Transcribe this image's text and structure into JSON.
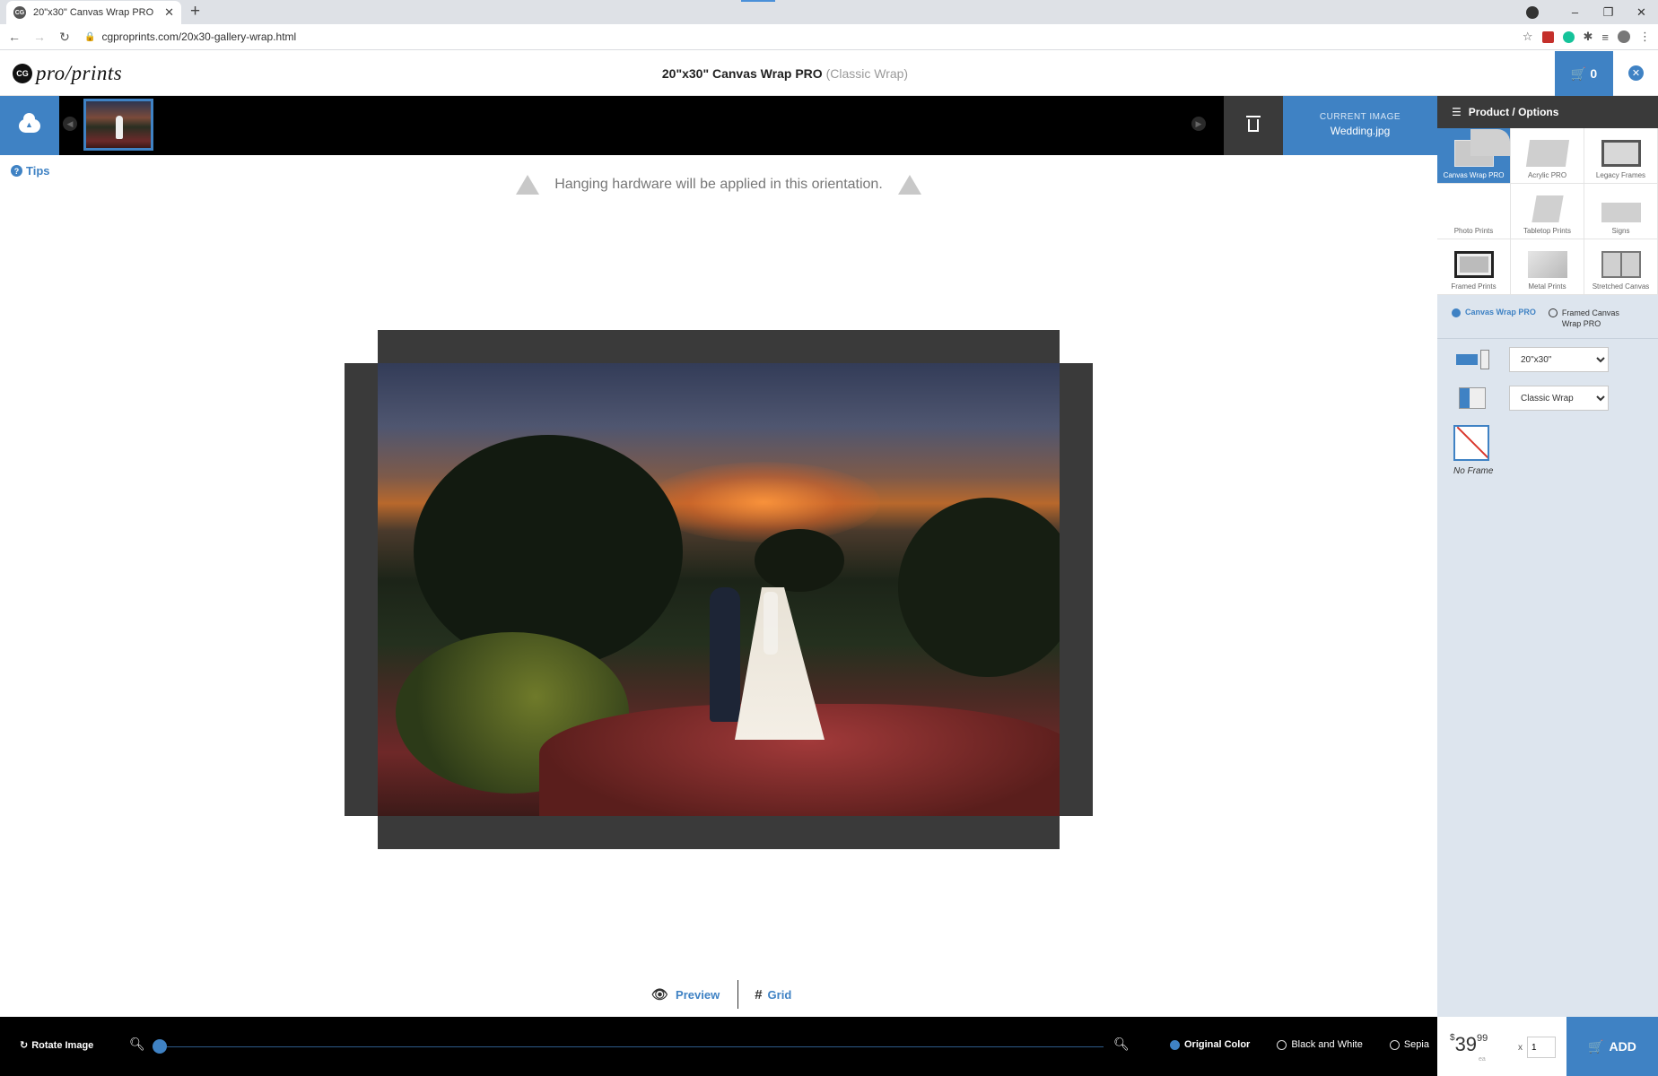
{
  "browser": {
    "tab_title": "20\"x30\" Canvas Wrap PRO",
    "favicon_text": "CG",
    "url": "cgproprints.com/20x30-gallery-wrap.html"
  },
  "header": {
    "logo_mark": "CG",
    "logo_text": "pro/prints",
    "product_title": "20\"x30\" Canvas Wrap PRO",
    "product_subtitle": "(Classic Wrap)",
    "cart_count": "0"
  },
  "strip": {
    "current_image_label": "CURRENT IMAGE",
    "current_image_name": "Wedding.jpg"
  },
  "canvas": {
    "tips_label": "Tips",
    "orientation_hint": "Hanging hardware will be applied in this orientation.",
    "preview_label": "Preview",
    "grid_label": "Grid"
  },
  "toolbar": {
    "rotate_label": "Rotate Image",
    "zoom_level": 0,
    "color_options": [
      "Original Color",
      "Black and White",
      "Sepia"
    ],
    "selected_color": "Original Color"
  },
  "panel": {
    "title": "Product / Options",
    "products": [
      {
        "label": "Canvas Wrap PRO",
        "selected": true
      },
      {
        "label": "Acrylic PRO"
      },
      {
        "label": "Legacy Frames"
      },
      {
        "label": "Photo Prints"
      },
      {
        "label": "Tabletop Prints"
      },
      {
        "label": "Signs"
      },
      {
        "label": "Framed Prints"
      },
      {
        "label": "Metal Prints"
      },
      {
        "label": "Stretched Canvas"
      }
    ],
    "sub_options": [
      "Canvas Wrap PRO",
      "Framed Canvas Wrap PRO"
    ],
    "size_value": "20\"x30\"",
    "wrap_value": "Classic Wrap",
    "frame_label": "No Frame",
    "price_dollars": "39",
    "price_cents": "99",
    "price_currency": "$",
    "price_unit": "ea",
    "qty_prefix": "x",
    "qty_value": "1",
    "add_label": "ADD"
  },
  "colors": {
    "accent": "#3f82c4",
    "dark": "#000000",
    "panel_bg": "#dde5ee"
  }
}
